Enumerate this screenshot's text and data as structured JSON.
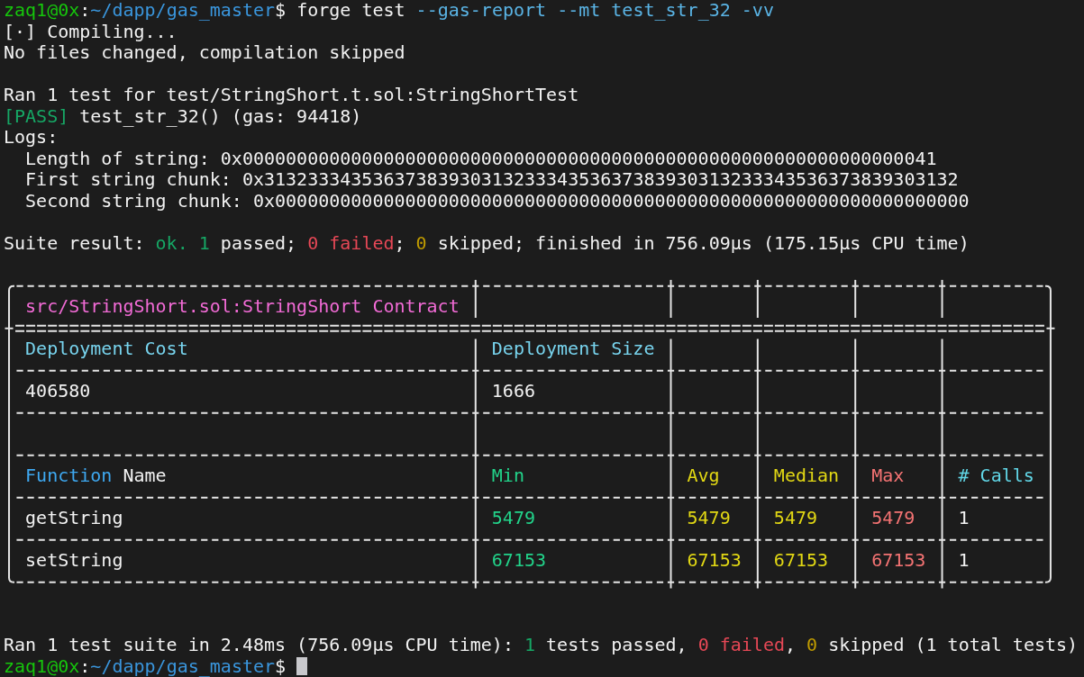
{
  "terminal": {
    "command": [
      {
        "kind": "user",
        "text": "zaq1@0x"
      },
      {
        "kind": "plain",
        "text": ":"
      },
      {
        "kind": "path",
        "text": "~/dapp/gas_master"
      },
      {
        "kind": "plain",
        "text": "$ forge test "
      },
      {
        "kind": "flag",
        "text": "--gas-report --mt test_str_32 -vv"
      }
    ],
    "compile_output": [
      "[·] Compiling...",
      "No files changed, compilation skipped"
    ],
    "test_run": {
      "header": "Ran 1 test for test/StringShort.t.sol:StringShortTest",
      "result": [
        {
          "kind": "pass",
          "text": "[PASS]"
        },
        {
          "kind": "plain",
          "text": " test_str_32() (gas: 94418)"
        }
      ],
      "logs_label": "Logs:",
      "logs": [
        "Length of string: 0x0000000000000000000000000000000000000000000000000000000000000041",
        "First string chunk: 0x3132333435363738393031323334353637383930313233343536373839303132",
        "Second string chunk: 0x0000000000000000000000000000000000000000000000000000000000000000"
      ]
    },
    "suite_result": [
      {
        "kind": "plain",
        "text": "Suite result: "
      },
      {
        "kind": "ok",
        "text": "ok. 1"
      },
      {
        "kind": "plain",
        "text": " passed; "
      },
      {
        "kind": "fail",
        "text": "0 failed"
      },
      {
        "kind": "plain",
        "text": "; "
      },
      {
        "kind": "skip",
        "text": "0"
      },
      {
        "kind": "plain",
        "text": " skipped; finished in 756.09µs (175.15µs CPU time)"
      }
    ],
    "gas_report": {
      "contract": "src/StringShort.sol:StringShort Contract",
      "deployment": {
        "headers": [
          "Deployment Cost",
          "Deployment Size"
        ],
        "values": [
          "406580",
          "1666"
        ]
      },
      "columns": [
        {
          "kind": "name",
          "label": [
            {
              "kind": "keyword",
              "text": "Function"
            },
            {
              "kind": "plain",
              "text": " Name"
            }
          ]
        },
        {
          "kind": "min",
          "label": [
            {
              "kind": "min",
              "text": "Min"
            }
          ]
        },
        {
          "kind": "avg",
          "label": [
            {
              "kind": "avg",
              "text": "Avg"
            }
          ]
        },
        {
          "kind": "median",
          "label": [
            {
              "kind": "median",
              "text": "Median"
            }
          ]
        },
        {
          "kind": "max",
          "label": [
            {
              "kind": "max",
              "text": "Max"
            }
          ]
        },
        {
          "kind": "calls",
          "label": [
            {
              "kind": "calls",
              "text": "# Calls"
            }
          ]
        }
      ],
      "rows": [
        {
          "cells": [
            "getString",
            "5479",
            "5479",
            "5479",
            "5479",
            "1"
          ]
        },
        {
          "cells": [
            "setString",
            "67153",
            "67153",
            "67153",
            "67153",
            "1"
          ]
        }
      ]
    },
    "summary": [
      {
        "kind": "plain",
        "text": "Ran 1 test suite in 2.48ms (756.09µs CPU time): "
      },
      {
        "kind": "ok",
        "text": "1"
      },
      {
        "kind": "plain",
        "text": " tests passed, "
      },
      {
        "kind": "fail",
        "text": "0 failed"
      },
      {
        "kind": "plain",
        "text": ", "
      },
      {
        "kind": "skip",
        "text": "0"
      },
      {
        "kind": "plain",
        "text": " skipped (1 total tests)"
      }
    ],
    "prompt": [
      {
        "kind": "user",
        "text": "zaq1@0x"
      },
      {
        "kind": "plain",
        "text": ":"
      },
      {
        "kind": "path",
        "text": "~/dapp/gas_master"
      },
      {
        "kind": "plain",
        "text": "$"
      }
    ]
  }
}
